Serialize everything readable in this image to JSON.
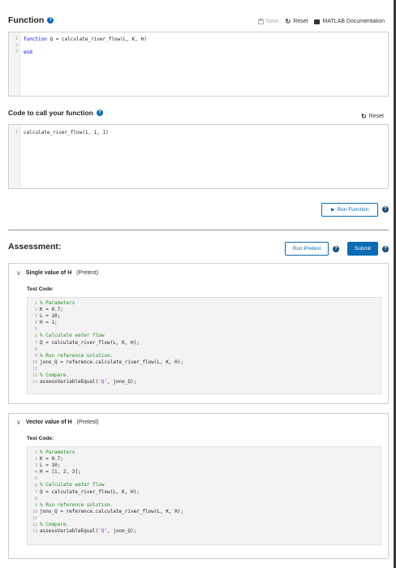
{
  "function_section": {
    "title": "Function",
    "toolbar": {
      "save": "Save",
      "reset": "Reset",
      "docs": "MATLAB Documentation"
    },
    "code": {
      "line1_kw": "function",
      "line1_rest": " Q = calculate_river_flow(L, K, H)",
      "line3_kw": "end"
    },
    "line_numbers": [
      "1",
      "2",
      "3"
    ]
  },
  "call_section": {
    "title": "Code to call your function",
    "reset": "Reset",
    "code_line": "calculate_river_flow(1, 1, 1)",
    "line_numbers": [
      "1"
    ],
    "run_button": "Run Function"
  },
  "assessment": {
    "title": "Assessment:",
    "run_pretest": "Run Pretest",
    "submit": "Submit",
    "tests": [
      {
        "name": "Single value of H",
        "tag": "(Pretest)",
        "label": "Test Code:",
        "lines": [
          {
            "n": "1",
            "text": "% Parameters",
            "type": "cm"
          },
          {
            "n": "2",
            "text": "K = 0.7;",
            "type": "plain"
          },
          {
            "n": "3",
            "text": "L = 10;",
            "type": "plain"
          },
          {
            "n": "4",
            "text": "H = 1;",
            "type": "plain"
          },
          {
            "n": "5",
            "text": "",
            "type": "plain"
          },
          {
            "n": "6",
            "text": "% Calculate water flow",
            "type": "cm"
          },
          {
            "n": "7",
            "text": "Q = calculate_river_flow(L, K, H);",
            "type": "plain"
          },
          {
            "n": "8",
            "text": "",
            "type": "plain"
          },
          {
            "n": "9",
            "text": "% Run reference solution.",
            "type": "cm"
          },
          {
            "n": "10",
            "text": "jono_Q = reference.calculate_river_flow(L, K, H);",
            "type": "plain"
          },
          {
            "n": "11",
            "text": "",
            "type": "plain"
          },
          {
            "n": "12",
            "text": "% Compare.",
            "type": "cm"
          },
          {
            "n": "13",
            "text": "assessVariableEqual(",
            "type": "plain",
            "str": "'Q'",
            "tail": ", jono_Q);"
          }
        ]
      },
      {
        "name": "Vector value of H",
        "tag": "(Pretest)",
        "label": "Test Code:",
        "lines": [
          {
            "n": "1",
            "text": "% Parameters",
            "type": "cm"
          },
          {
            "n": "2",
            "text": "K = 0.7;",
            "type": "plain"
          },
          {
            "n": "3",
            "text": "L = 10;",
            "type": "plain"
          },
          {
            "n": "4",
            "text": "H = [1, 2, 3];",
            "type": "plain"
          },
          {
            "n": "5",
            "text": "",
            "type": "plain"
          },
          {
            "n": "6",
            "text": "% Calculate water flow",
            "type": "cm"
          },
          {
            "n": "7",
            "text": "Q = calculate_river_flow(L, K, H);",
            "type": "plain"
          },
          {
            "n": "8",
            "text": "",
            "type": "plain"
          },
          {
            "n": "9",
            "text": "% Run reference solution.",
            "type": "cm"
          },
          {
            "n": "10",
            "text": "jono_Q = reference.calculate_river_flow(L, K, H);",
            "type": "plain"
          },
          {
            "n": "11",
            "text": "",
            "type": "plain"
          },
          {
            "n": "12",
            "text": "% Compare.",
            "type": "cm"
          },
          {
            "n": "13",
            "text": "assessVariableEqual(",
            "type": "plain",
            "str": "'Q'",
            "tail": ", jono_Q);"
          }
        ]
      }
    ]
  },
  "colors": {
    "accent": "#0b6bb5",
    "comment": "#228b22",
    "keyword": "#0000ff",
    "string": "#a020f0"
  }
}
